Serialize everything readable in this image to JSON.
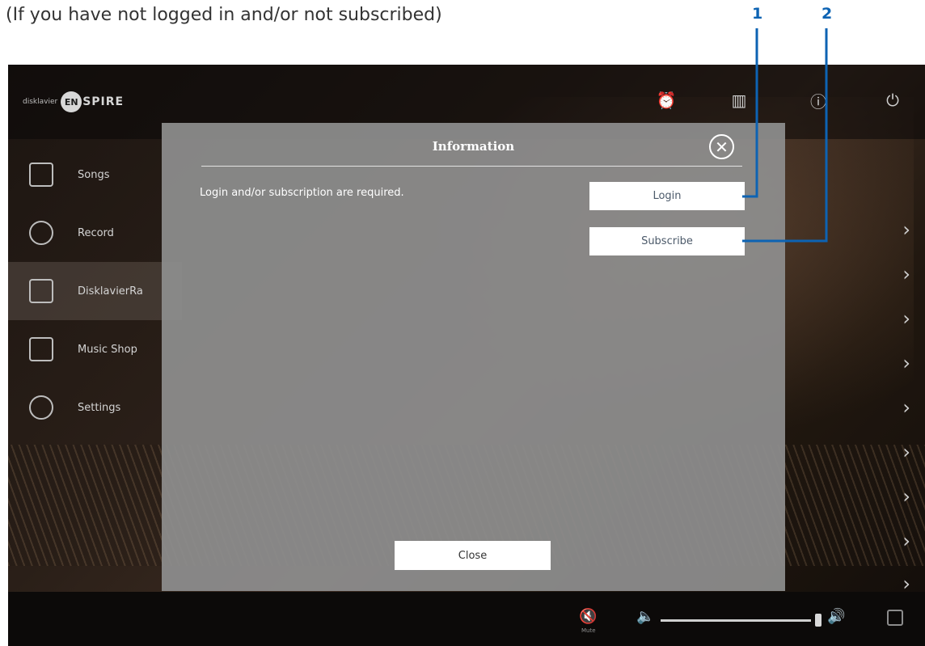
{
  "caption": "(If you have not logged in and/or not subscribed)",
  "callouts": [
    "1",
    "2"
  ],
  "callout_color": "#0d63b3",
  "app": {
    "logo_small": "disklavier",
    "logo_badge": "EN",
    "logo_rest": "SPIRE",
    "top_icons": [
      "alarm-icon",
      "keyboard-icon",
      "info-icon",
      "power-icon"
    ]
  },
  "sidebar": {
    "items": [
      {
        "label": "Songs",
        "icon": "songs-icon"
      },
      {
        "label": "Record",
        "icon": "record-icon"
      },
      {
        "label": "DisklavierRa",
        "icon": "radio-icon",
        "active": true
      },
      {
        "label": "Music Shop",
        "icon": "cart-icon"
      },
      {
        "label": "Settings",
        "icon": "gear-icon"
      }
    ]
  },
  "dialog": {
    "title": "Information",
    "message": "Login and/or subscription are required.",
    "login_label": "Login",
    "subscribe_label": "Subscribe",
    "close_label": "Close",
    "close_icon": "close-icon"
  },
  "bottombar": {
    "mute_label": "Mute",
    "icons": [
      "mute-icon",
      "volume-low-icon",
      "volume-high-icon",
      "grid-icon"
    ]
  }
}
